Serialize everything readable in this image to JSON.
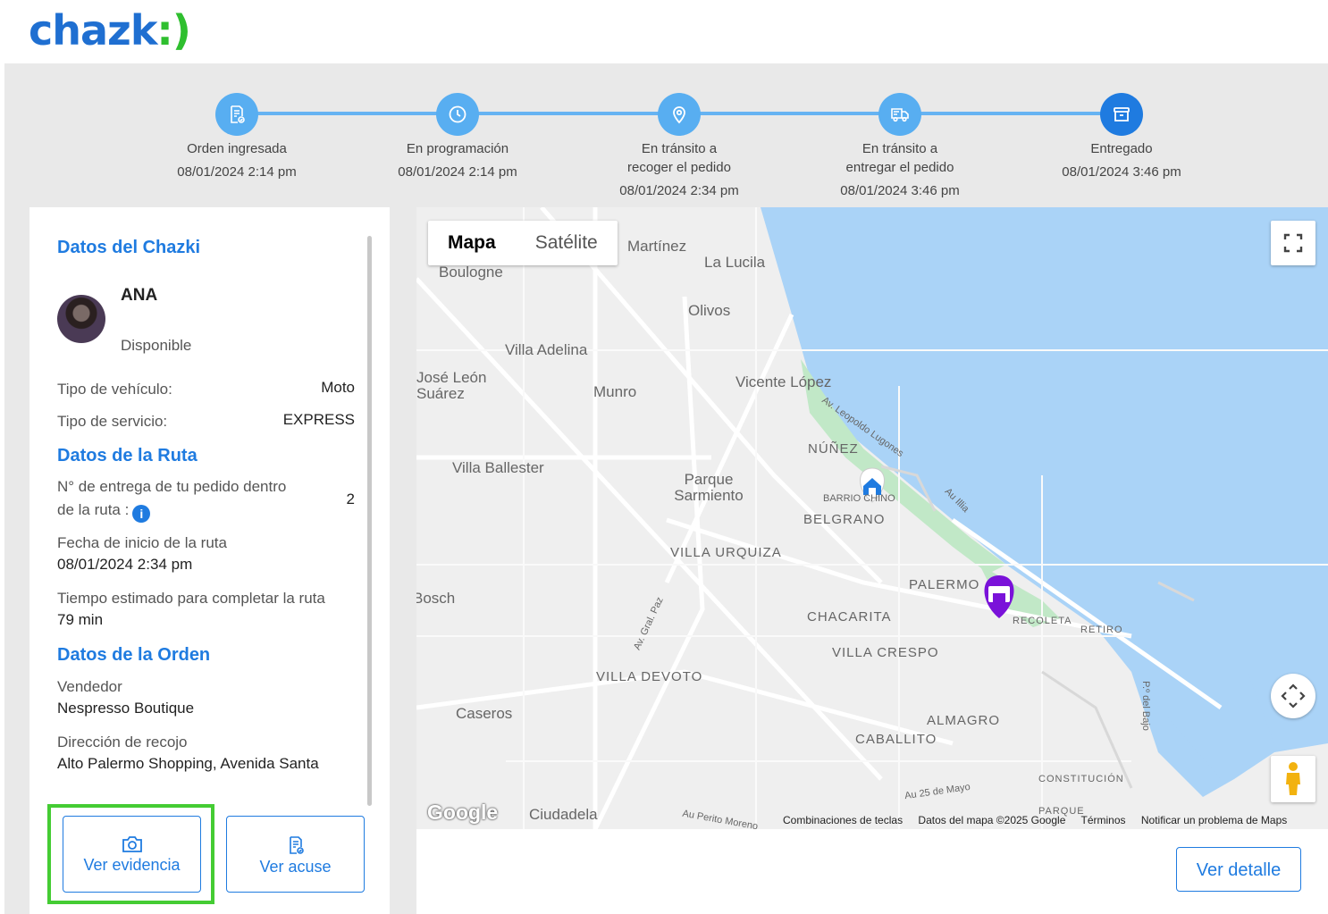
{
  "logo": {
    "text": "chazk",
    "mark": ":)"
  },
  "timeline": [
    {
      "label": "Orden ingresada",
      "date": "08/01/2024 2:14 pm",
      "icon": "document-check-icon"
    },
    {
      "label": "En programación",
      "date": "08/01/2024 2:14 pm",
      "icon": "clock-icon"
    },
    {
      "label": "En tránsito a recoger el pedido",
      "line1": "En tránsito a",
      "line2": "recoger el pedido",
      "date": "08/01/2024 2:34 pm",
      "icon": "location-pin-icon"
    },
    {
      "label": "En tránsito a entregar el pedido",
      "line1": "En tránsito a",
      "line2": "entregar el pedido",
      "date": "08/01/2024 3:46 pm",
      "icon": "delivery-truck-icon"
    },
    {
      "label": "Entregado",
      "date": "08/01/2024 3:46 pm",
      "icon": "archive-box-icon",
      "active": true
    }
  ],
  "chazki": {
    "title": "Datos del Chazki",
    "name": "ANA",
    "status": "Disponible",
    "vehicle_label": "Tipo de vehículo:",
    "vehicle_value": "Moto",
    "service_label": "Tipo de servicio:",
    "service_value": "EXPRESS"
  },
  "route": {
    "title": "Datos de la Ruta",
    "delivery_num_label_1": "N° de entrega de tu pedido dentro",
    "delivery_num_label_2": "de la ruta :",
    "delivery_num_value": "2",
    "start_label": "Fecha de inicio de la ruta",
    "start_value": "08/01/2024 2:34 pm",
    "eta_label": "Tiempo estimado para completar la ruta",
    "eta_value": "79 min"
  },
  "order": {
    "title": "Datos de la Orden",
    "seller_label": "Vendedor",
    "seller_value": "Nespresso Boutique",
    "pickup_label": "Dirección de recojo",
    "pickup_value": "Alto Palermo Shopping, Avenida Santa"
  },
  "buttons": {
    "evidence": "Ver evidencia",
    "receipt": "Ver acuse",
    "detail": "Ver detalle"
  },
  "map": {
    "type_map": "Mapa",
    "type_satellite": "Satélite",
    "google": "Google",
    "attribution": [
      "Combinaciones de teclas",
      "Datos del mapa ©2025 Google",
      "Términos",
      "Notificar un problema de Maps"
    ],
    "places": [
      "Boulogne",
      "Martínez",
      "La Lucila",
      "Olivos",
      "Villa Adelina",
      "José León Suárez",
      "Munro",
      "Vicente López",
      "Av. Leopoldo Lugones",
      "Villa Ballester",
      "NÚÑEZ",
      "Parque Sarmiento",
      "BARRIO CHINO",
      "BELGRANO",
      "Au Illia",
      "VILLA URQUIZA",
      "PALERMO",
      "Bosch",
      "Av. Gral. Paz",
      "CHACARITA",
      "RECOLETA",
      "RETIRO",
      "VILLA CRESPO",
      "VILLA DEVOTO",
      "P.º del Bajo",
      "Caseros",
      "ALMAGRO",
      "CABALLITO",
      "CONSTITUCIÓN",
      "Au 25 de Mayo",
      "Ciudadela",
      "Au Perito Moreno",
      "PARQUE"
    ]
  },
  "colors": {
    "accent": "#1f7be0",
    "step": "#58aef1",
    "highlight": "#44cc33",
    "water": "#aad3f7",
    "park": "#c1e8c7",
    "purple_marker": "#7a12d9"
  }
}
